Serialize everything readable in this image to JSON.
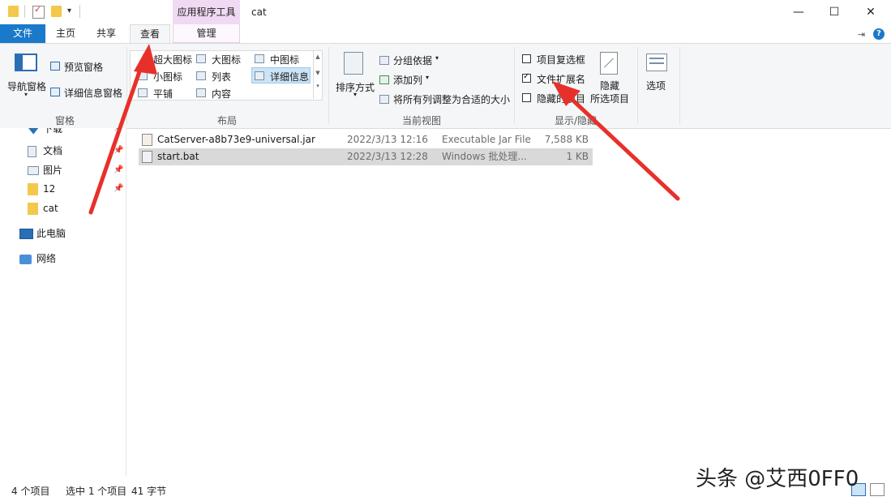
{
  "titlebar": {
    "contextual_tab": "应用程序工具",
    "title": "cat",
    "minimize": "—",
    "maximize": "☐",
    "close": "✕"
  },
  "tabs": {
    "file": "文件",
    "home": "主页",
    "share": "共享",
    "view": "查看",
    "manage": "管理"
  },
  "ribbon": {
    "panes": {
      "nav_pane": "导航窗格",
      "preview_pane": "预览窗格",
      "details_pane": "详细信息窗格",
      "label": "窗格"
    },
    "layout": {
      "extra_large": "超大图标",
      "large": "大图标",
      "medium": "中图标",
      "small": "小图标",
      "list": "列表",
      "details": "详细信息",
      "tiles": "平铺",
      "content": "内容",
      "label": "布局"
    },
    "current_view": {
      "sort_by": "排序方式",
      "group_by": "分组依据",
      "add_column": "添加列",
      "fit_columns": "将所有列调整为合适的大小",
      "label": "当前视图"
    },
    "show_hide": {
      "item_checkboxes": "项目复选框",
      "file_extensions": "文件扩展名",
      "hidden_items": "隐藏的项目",
      "hide_selected": "隐藏",
      "hide_selected_2": "所选项目",
      "label": "显示/隐藏",
      "file_extensions_checked": true
    },
    "options": "选项"
  },
  "nav": {
    "items": [
      {
        "label": "下载",
        "pinned": true
      },
      {
        "label": "文档",
        "pinned": true
      },
      {
        "label": "图片",
        "pinned": true
      },
      {
        "label": "12",
        "pinned": true
      },
      {
        "label": "cat",
        "pinned": false
      }
    ],
    "this_pc": "此电脑",
    "network": "网络"
  },
  "files": [
    {
      "name": "CatServer-a8b73e9-universal.jar",
      "date": "2022/3/13 12:16",
      "type": "Executable Jar File",
      "size": "7,588 KB",
      "selected": false
    },
    {
      "name": "start.bat",
      "date": "2022/3/13 12:28",
      "type": "Windows 批处理...",
      "size": "1 KB",
      "selected": true
    }
  ],
  "status": {
    "count": "4 个项目",
    "selection": "选中 1 个项目",
    "bytes": "41 字节"
  },
  "watermark": "头条 @艾西0FF0",
  "colors": {
    "file_tab": "#1979ca",
    "context_tab": "#f0d9f3",
    "arrow": "#e8302a",
    "selection": "#d9d9d9"
  }
}
